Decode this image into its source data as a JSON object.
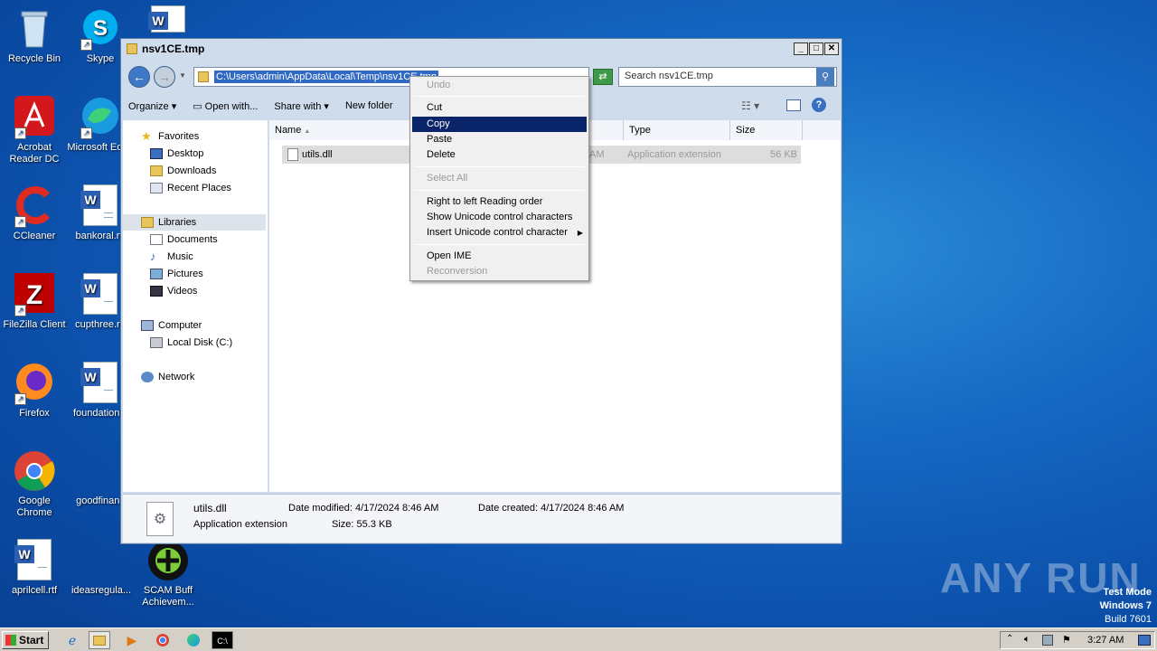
{
  "desktop": {
    "icons": [
      {
        "label": "Recycle Bin"
      },
      {
        "label": "Skype"
      },
      {
        "label": "Acrobat Reader DC"
      },
      {
        "label": "Microsoft Edge"
      },
      {
        "label": "CCleaner"
      },
      {
        "label": "bankoral.rtf"
      },
      {
        "label": "FileZilla Client"
      },
      {
        "label": "cupthree.rtf"
      },
      {
        "label": "Firefox"
      },
      {
        "label": "foundationm"
      },
      {
        "label": "Google Chrome"
      },
      {
        "label": "goodfinanc"
      },
      {
        "label": "aprilcell.rtf"
      },
      {
        "label": "ideasregula..."
      },
      {
        "label": "SCAM Buff Achievem..."
      }
    ],
    "watermark": "ANY RUN",
    "testmode": [
      "Test Mode",
      "Windows 7",
      "Build 7601"
    ]
  },
  "window": {
    "title": "nsv1CE.tmp",
    "address": "C:\\Users\\admin\\AppData\\Local\\Temp\\nsv1CE.tmp",
    "search_placeholder": "Search nsv1CE.tmp",
    "commands": [
      "Organize",
      "Open with...",
      "Share with",
      "New folder"
    ],
    "nav": {
      "favorites": "Favorites",
      "desktop": "Desktop",
      "downloads": "Downloads",
      "recent": "Recent Places",
      "libraries": "Libraries",
      "documents": "Documents",
      "music": "Music",
      "pictures": "Pictures",
      "videos": "Videos",
      "computer": "Computer",
      "localdisk": "Local Disk (C:)",
      "network": "Network"
    },
    "columns": {
      "name": "Name",
      "type": "Type",
      "size": "Size"
    },
    "file": {
      "name": "utils.dll",
      "date_tail": "AM",
      "type": "Application extension",
      "size": "56 KB"
    },
    "details": {
      "name": "utils.dll",
      "type": "Application extension",
      "modified_label": "Date modified:",
      "modified": "4/17/2024 8:46 AM",
      "created_label": "Date created:",
      "created": "4/17/2024 8:46 AM",
      "size_label": "Size:",
      "size": "55.3 KB"
    }
  },
  "context_menu": {
    "undo": "Undo",
    "cut": "Cut",
    "copy": "Copy",
    "paste": "Paste",
    "delete": "Delete",
    "select_all": "Select All",
    "rtl": "Right to left Reading order",
    "show_unicode": "Show Unicode control characters",
    "insert_unicode": "Insert Unicode control character",
    "open_ime": "Open IME",
    "reconversion": "Reconversion"
  },
  "taskbar": {
    "start": "Start",
    "clock": "3:27 AM"
  }
}
